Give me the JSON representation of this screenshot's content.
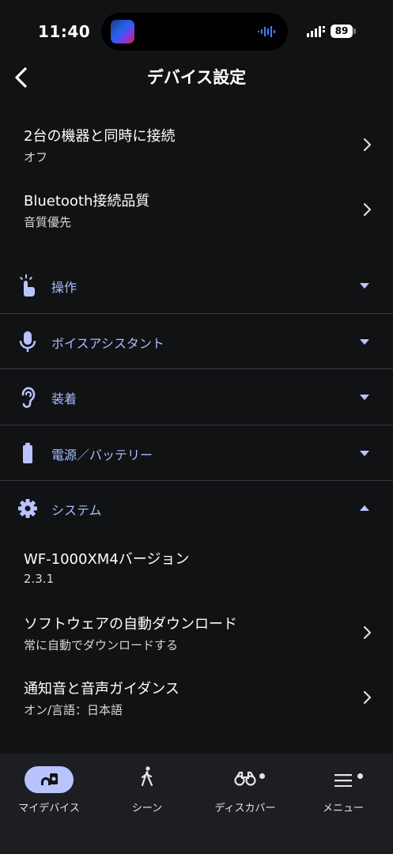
{
  "status_bar": {
    "time": "11:40",
    "battery": "89"
  },
  "header": {
    "title": "デバイス設定"
  },
  "top_rows": [
    {
      "title": "2台の機器と同時に接続",
      "sub": "オフ"
    },
    {
      "title": "Bluetooth接続品質",
      "sub": "音質優先"
    }
  ],
  "sections": [
    {
      "label": "操作",
      "icon": "tap-icon",
      "expanded": false
    },
    {
      "label": "ボイスアシスタント",
      "icon": "microphone-icon",
      "expanded": false
    },
    {
      "label": "装着",
      "icon": "ear-icon",
      "expanded": false
    },
    {
      "label": "電源／バッテリー",
      "icon": "battery-icon",
      "expanded": false
    },
    {
      "label": "システム",
      "icon": "gear-icon",
      "expanded": true
    }
  ],
  "system_rows": [
    {
      "title": "WF-1000XM4バージョン",
      "sub": "2.3.1"
    },
    {
      "title": "ソフトウェアの自動ダウンロード",
      "sub": "常に自動でダウンロードする"
    },
    {
      "title": "通知音と音声ガイダンス",
      "sub": "オン/言語：日本語"
    }
  ],
  "tabs": [
    {
      "label": "マイデバイス",
      "icon": "my-device-icon",
      "active": true
    },
    {
      "label": "シーン",
      "icon": "walking-icon"
    },
    {
      "label": "ディスカバー",
      "icon": "binoculars-icon",
      "badge": true
    },
    {
      "label": "メニュー",
      "icon": "menu-icon",
      "badge": true
    }
  ],
  "colors": {
    "background": "#111214",
    "accent": "#a9bcff",
    "tabbar": "#1d1e21",
    "pill": "#b9c4ff"
  }
}
